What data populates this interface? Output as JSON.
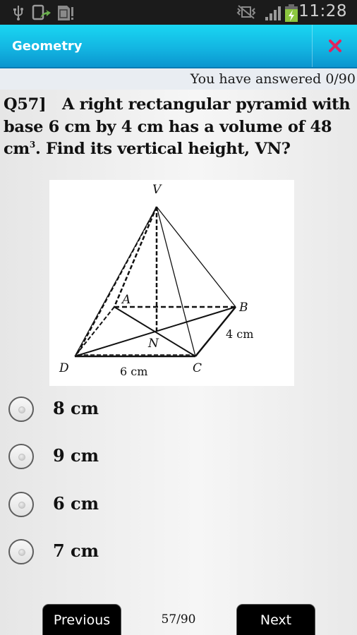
{
  "status_bar": {
    "time": "11:28",
    "left_icons": [
      "usb-icon",
      "screen-share-icon",
      "sd-card-warning-icon"
    ],
    "right_icons": [
      "vibrate-mute-icon",
      "signal-icon",
      "battery-charging-icon"
    ],
    "battery_color": "#8cc63f"
  },
  "action_bar": {
    "title": "Geometry",
    "close_icon": "close-icon",
    "close_color": "#e0245e",
    "accent_color": "#13b6e2"
  },
  "progress": {
    "answered_text": "You have answered 0/90"
  },
  "question": {
    "number": "Q57]",
    "text_before_sup": "A right rectangular pyramid with base 6 cm by 4 cm has a volume of 48 cm",
    "sup": "3",
    "text_after_sup": ". Find its vertical height, VN?"
  },
  "figure": {
    "vertex_labels": {
      "V": "V",
      "A": "A",
      "B": "B",
      "C": "C",
      "D": "D",
      "N": "N"
    },
    "dimension_labels": {
      "base_length": "6 cm",
      "base_width": "4 cm"
    }
  },
  "options": [
    {
      "label": "8 cm",
      "selected": false
    },
    {
      "label": "9 cm",
      "selected": false
    },
    {
      "label": "6 cm",
      "selected": false
    },
    {
      "label": "7 cm",
      "selected": false
    }
  ],
  "navigation": {
    "previous_label": "Previous",
    "next_label": "Next",
    "page_indicator": "57/90"
  }
}
